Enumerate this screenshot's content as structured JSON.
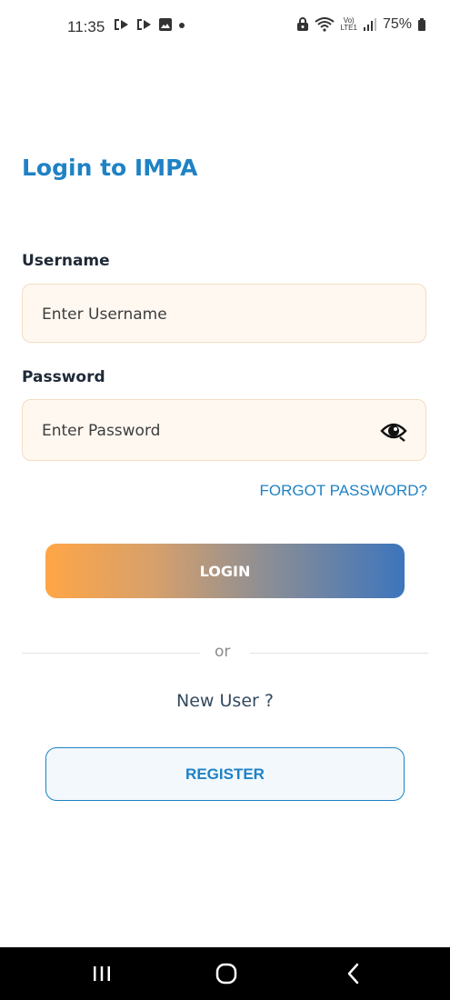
{
  "status_bar": {
    "time": "11:35",
    "battery": "75%",
    "left_icons": [
      "notification-icon",
      "notification-icon",
      "gallery-icon",
      "dot-icon"
    ],
    "right_icons": [
      "lock-icon",
      "wifi-icon",
      "volte-icon",
      "signal-icon",
      "battery-icon"
    ],
    "volte_text": "Vo)",
    "lte_text": "LTE1"
  },
  "page": {
    "title": "Login to IMPA",
    "username_label": "Username",
    "username_placeholder": "Enter Username",
    "password_label": "Password",
    "password_placeholder": "Enter Password",
    "forgot_password": "FORGOT PASSWORD?",
    "login_button": "LOGIN",
    "divider_text": "or",
    "new_user_text": "New User ?",
    "register_button": "REGISTER"
  },
  "colors": {
    "accent": "#1f82c4",
    "input_bg": "#fff8f1",
    "gradient_start": "#ffa646",
    "gradient_end": "#3d75bd"
  }
}
